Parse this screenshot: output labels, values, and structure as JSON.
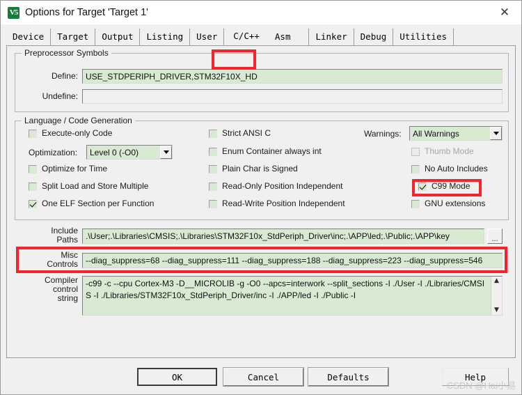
{
  "window": {
    "title": "Options for Target 'Target 1'",
    "icon": "keil-uvision-icon",
    "close_label": "✕"
  },
  "tabs": [
    {
      "label": "Device",
      "selected": false
    },
    {
      "label": "Target",
      "selected": false
    },
    {
      "label": "Output",
      "selected": false
    },
    {
      "label": "Listing",
      "selected": false
    },
    {
      "label": "User",
      "selected": false
    },
    {
      "label": "C/C++",
      "selected": true
    },
    {
      "label": "Asm",
      "selected": false
    },
    {
      "label": "Linker",
      "selected": false
    },
    {
      "label": "Debug",
      "selected": false
    },
    {
      "label": "Utilities",
      "selected": false
    }
  ],
  "preprocessor": {
    "legend": "Preprocessor Symbols",
    "define_label": "Define:",
    "define_value": "USE_STDPERIPH_DRIVER,STM32F10X_HD",
    "undefine_label": "Undefine:",
    "undefine_value": ""
  },
  "language": {
    "legend": "Language / Code Generation",
    "left_checks": [
      {
        "label": "Execute-only Code",
        "checked": false,
        "disabled": false
      },
      {
        "label": "Optimize for Time",
        "checked": false,
        "disabled": false
      },
      {
        "label": "Split Load and Store Multiple",
        "checked": false,
        "disabled": false
      },
      {
        "label": "One ELF Section per Function",
        "checked": true,
        "disabled": false
      }
    ],
    "optimization_label": "Optimization:",
    "optimization_value": "Level 0 (-O0)",
    "mid_checks": [
      {
        "label": "Strict ANSI C",
        "checked": false,
        "disabled": false
      },
      {
        "label": "Enum Container always int",
        "checked": false,
        "disabled": false
      },
      {
        "label": "Plain Char is Signed",
        "checked": false,
        "disabled": false
      },
      {
        "label": "Read-Only Position Independent",
        "checked": false,
        "disabled": false
      },
      {
        "label": "Read-Write Position Independent",
        "checked": false,
        "disabled": false
      }
    ],
    "warnings_label": "Warnings:",
    "warnings_value": "All Warnings",
    "right_checks": [
      {
        "label": "Thumb Mode",
        "checked": false,
        "disabled": true
      },
      {
        "label": "No Auto Includes",
        "checked": false,
        "disabled": false
      },
      {
        "label": "C99 Mode",
        "checked": true,
        "disabled": false
      },
      {
        "label": "GNU extensions",
        "checked": false,
        "disabled": false
      }
    ]
  },
  "paths": {
    "include_label_line1": "Include",
    "include_label_line2": "Paths",
    "include_value": ".\\User;.\\Libraries\\CMSIS;.\\Libraries\\STM32F10x_StdPeriph_Driver\\inc;.\\APP\\led;.\\Public;.\\APP\\key",
    "browse_label": "...",
    "misc_label_line1": "Misc",
    "misc_label_line2": "Controls",
    "misc_value": "--diag_suppress=68 --diag_suppress=111 --diag_suppress=188 --diag_suppress=223 --diag_suppress=546",
    "compiler_label_line1": "Compiler",
    "compiler_label_line2": "control",
    "compiler_label_line3": "string",
    "compiler_value": "-c99 -c --cpu Cortex-M3 -D__MICROLIB -g -O0 --apcs=interwork --split_sections -I ./User -I ./Libraries/CMSIS -I ./Libraries/STM32F10x_StdPeriph_Driver/inc -I ./APP/led -I ./Public -I",
    "scroll_up": "▲",
    "scroll_down": "▼"
  },
  "footer": {
    "ok": "OK",
    "cancel": "Cancel",
    "defaults": "Defaults",
    "help": "Help"
  },
  "watermark": "CSDN @Hai小易",
  "colors": {
    "highlight_red": "#f4232c",
    "field_green": "#d9ead3",
    "dialog_bg": "#f0f0f0"
  }
}
